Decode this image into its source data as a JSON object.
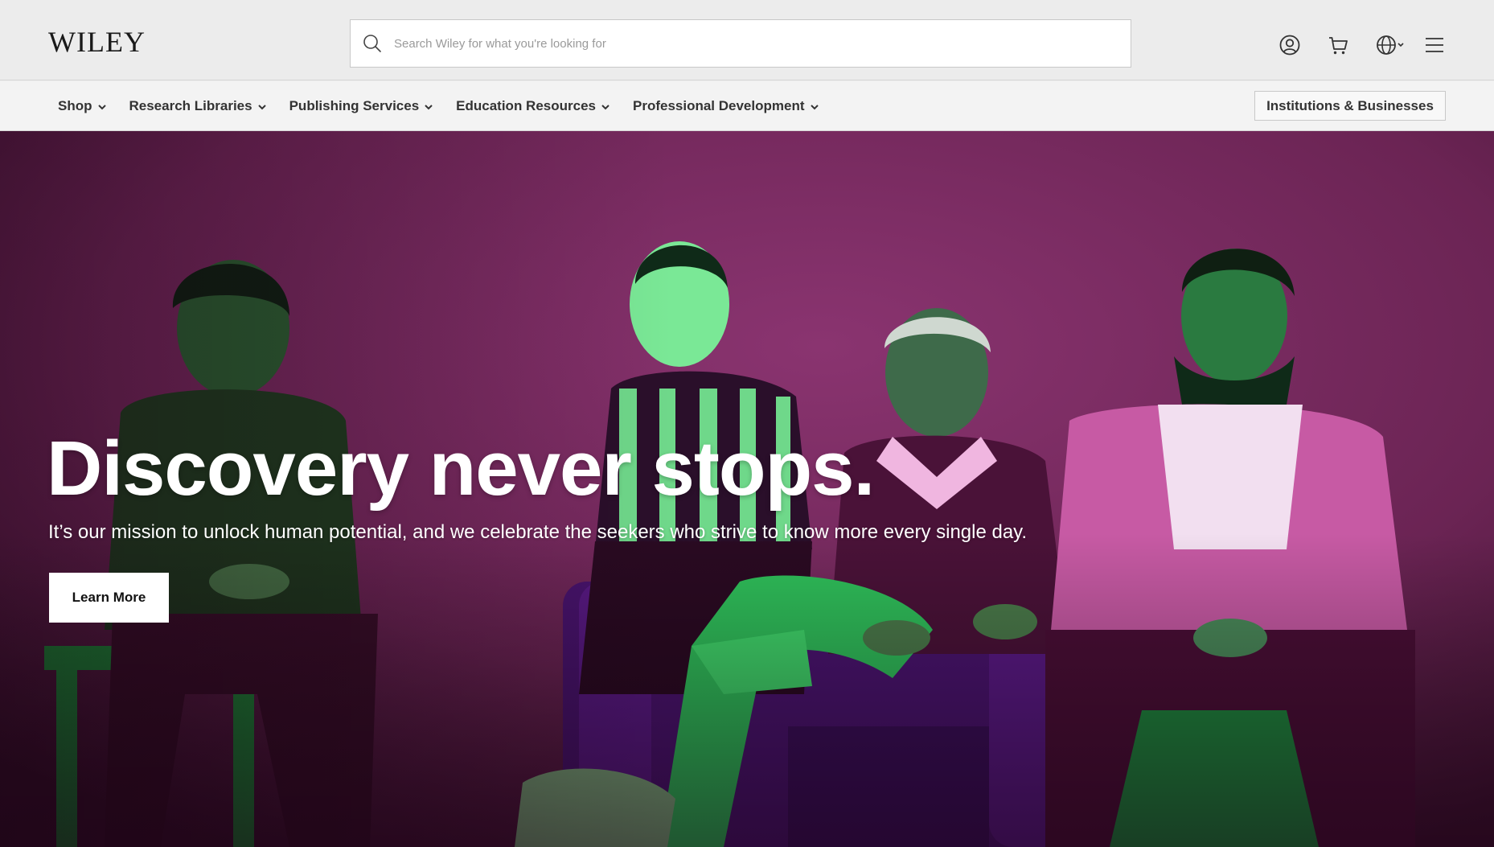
{
  "header": {
    "logo": "WILEY",
    "search": {
      "placeholder": "Search Wiley for what you're looking for",
      "icon": "search-icon"
    },
    "icons": [
      "account-icon",
      "cart-icon",
      "globe-icon",
      "menu-icon"
    ]
  },
  "nav": {
    "items": [
      {
        "label": "Shop"
      },
      {
        "label": "Research Libraries"
      },
      {
        "label": "Publishing Services"
      },
      {
        "label": "Education Resources"
      },
      {
        "label": "Professional Development"
      }
    ],
    "institutions_label": "Institutions & Businesses"
  },
  "hero": {
    "title": "Discovery never stops.",
    "subtitle": "It’s our mission to unlock human potential, and we celebrate the seekers who strive to know more every single day.",
    "cta_label": "Learn More",
    "colors": {
      "background": "#6a2452",
      "accent_green": "#2fbf5a",
      "accent_purple": "#5a1a86",
      "accent_pink": "#c75aa4"
    }
  }
}
